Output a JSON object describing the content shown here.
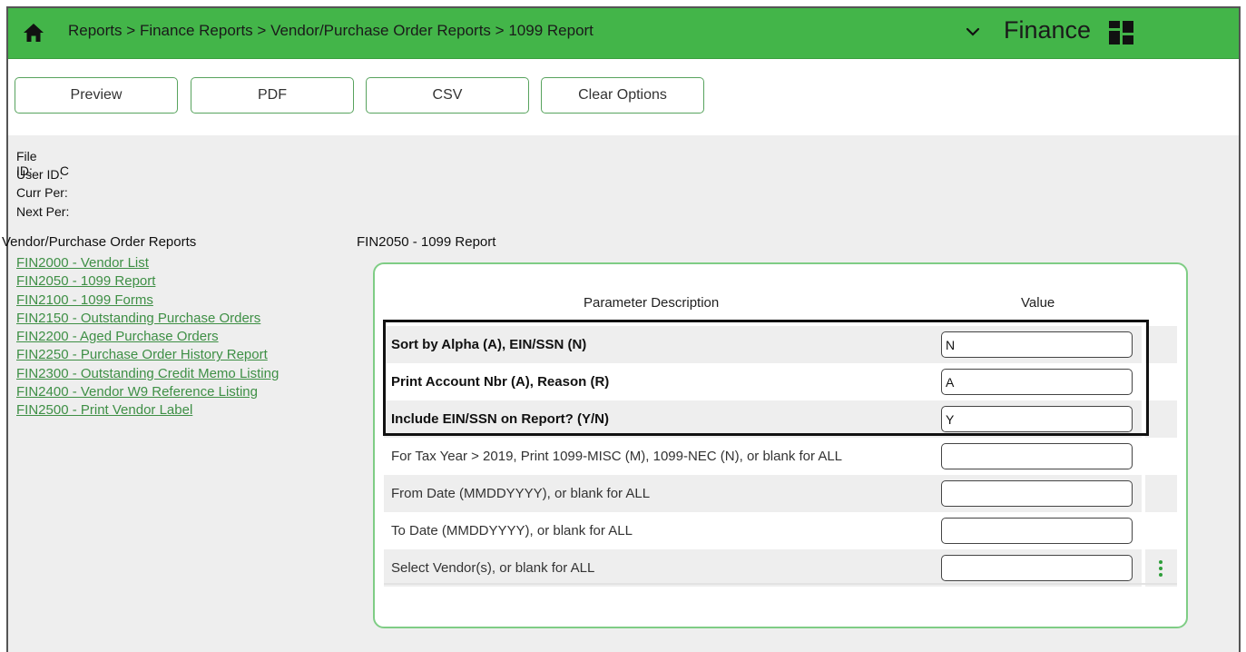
{
  "breadcrumb": {
    "items": [
      "Reports",
      "Finance Reports",
      "Vendor/Purchase Order Reports",
      "1099 Report"
    ],
    "separator": ">"
  },
  "module": {
    "name": "Finance"
  },
  "icons": {
    "home": "home-icon",
    "chevron": "chevron-down-icon",
    "grid": "grid-icon",
    "more": "more-vertical-icon"
  },
  "colors": {
    "header": "#43b549",
    "link": "#3e8f45",
    "panel_border": "#7fcd85",
    "button_border": "#58a35e"
  },
  "toolbar": {
    "preview": "Preview",
    "pdf": "PDF",
    "csv": "CSV",
    "clear": "Clear Options"
  },
  "info": {
    "file_id_label": "File ID:",
    "file_id_value": "C",
    "user_id_label": "User ID:",
    "curr_per_label": "Curr Per:",
    "next_per_label": "Next Per:"
  },
  "sidebar": {
    "title": "Vendor/Purchase Order Reports",
    "links": [
      "FIN2000 - Vendor List",
      "FIN2050 - 1099 Report",
      "FIN2100 - 1099 Forms",
      "FIN2150 - Outstanding Purchase Orders",
      "FIN2200 - Aged Purchase Orders",
      "FIN2250 - Purchase Order History Report",
      "FIN2300 - Outstanding Credit Memo Listing",
      "FIN2400 - Vendor W9 Reference Listing",
      "FIN2500 - Print Vendor Label"
    ]
  },
  "report": {
    "title": "FIN2050 - 1099 Report",
    "col_param": "Parameter Description",
    "col_value": "Value",
    "params": [
      {
        "label": "Sort by Alpha (A), EIN/SSN (N)",
        "value": "N"
      },
      {
        "label": "Print Account Nbr (A), Reason (R)",
        "value": "A"
      },
      {
        "label": "Include EIN/SSN on Report? (Y/N)",
        "value": "Y"
      },
      {
        "label": "For Tax Year > 2019, Print 1099-MISC (M), 1099-NEC (N), or blank for ALL",
        "value": ""
      },
      {
        "label": "From Date (MMDDYYYY), or blank for ALL",
        "value": ""
      },
      {
        "label": "To Date (MMDDYYYY), or blank for ALL",
        "value": ""
      },
      {
        "label": "Select Vendor(s), or blank for ALL",
        "value": ""
      }
    ]
  }
}
